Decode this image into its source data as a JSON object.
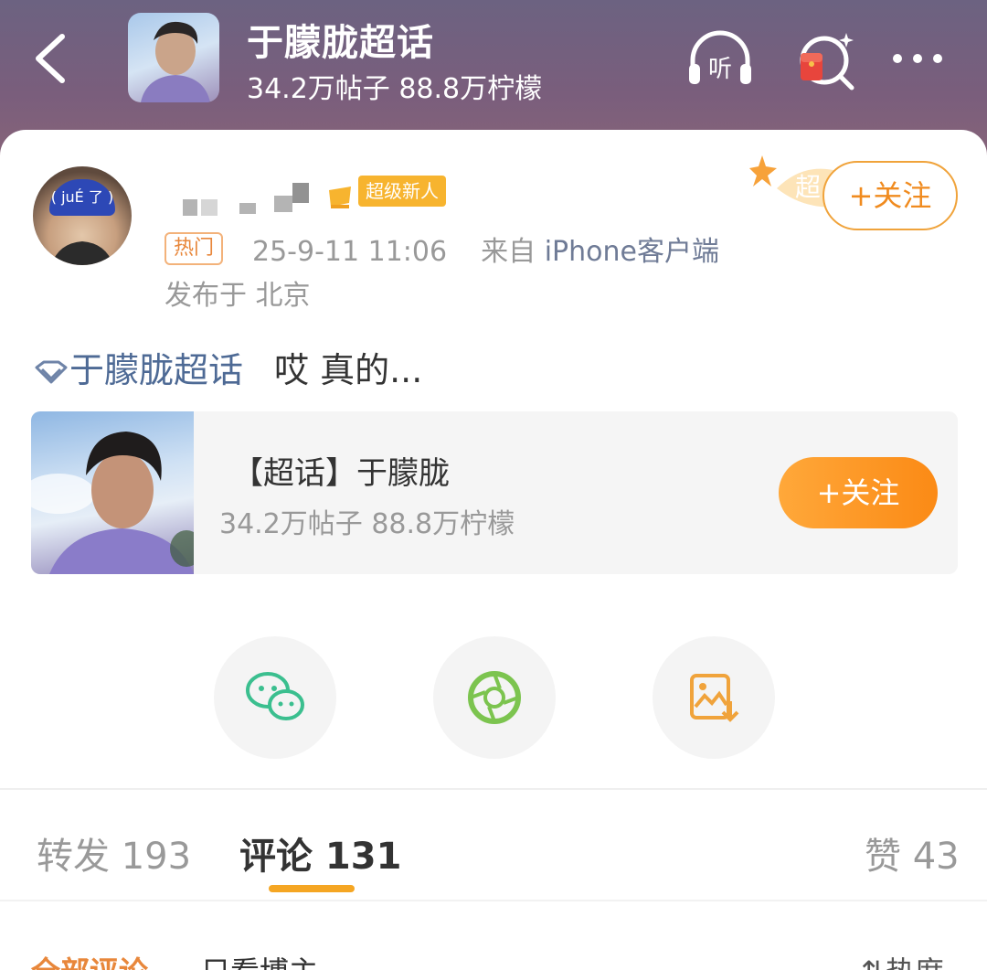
{
  "header": {
    "title": "于朦胧超话",
    "subtitle": "34.2万帖子 88.8万柠檬",
    "listen_label": "听"
  },
  "post": {
    "badge_label": "超级新人",
    "hot_tag": "热门",
    "timestamp": "25-9-11 11:06",
    "source_prefix": "来自",
    "source_client": "iPhone客户端",
    "location": "发布于 北京",
    "follow_label": "+关注",
    "avatar_cap_text": "( juÉ 了 )",
    "topic_link": "于朦胧超话",
    "text": "哎 真的..."
  },
  "topic_card": {
    "title": "【超话】于朦胧",
    "subtitle": "34.2万帖子 88.8万柠檬",
    "follow_label": "+关注"
  },
  "tabs": {
    "repost": "转发 193",
    "comments": "评论 131",
    "likes": "赞 43"
  },
  "comments_bar": {
    "all": "全部评论",
    "owner_only": "只看博主",
    "sort": "热度"
  },
  "colors": {
    "accent_orange": "#f5a623",
    "link_blue": "#4e6a95",
    "wechat_green": "#3bbf8f",
    "moments_green": "#7cc44f"
  }
}
